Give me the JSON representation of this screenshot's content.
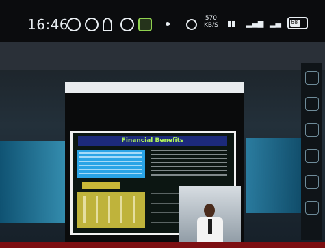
{
  "status_bar": {
    "time": "16:46",
    "network_speed": "570",
    "network_unit": "KB/S",
    "battery_label": "68",
    "battery_level": 0.68,
    "icons": [
      "circle-icon",
      "search-icon",
      "notification-icon",
      "google-icon",
      "app-icon",
      "dot-icon",
      "wifi-icon",
      "signal-icon",
      "signal-icon",
      "battery-icon"
    ]
  },
  "presentation": {
    "slide_title": "Financial Benefits"
  },
  "colors": {
    "slide_title_bg": "#1c2a7a",
    "slide_title_text": "#aef05a",
    "blue_box": "#2aa4e6",
    "yellow_box": "#bfb33b"
  }
}
